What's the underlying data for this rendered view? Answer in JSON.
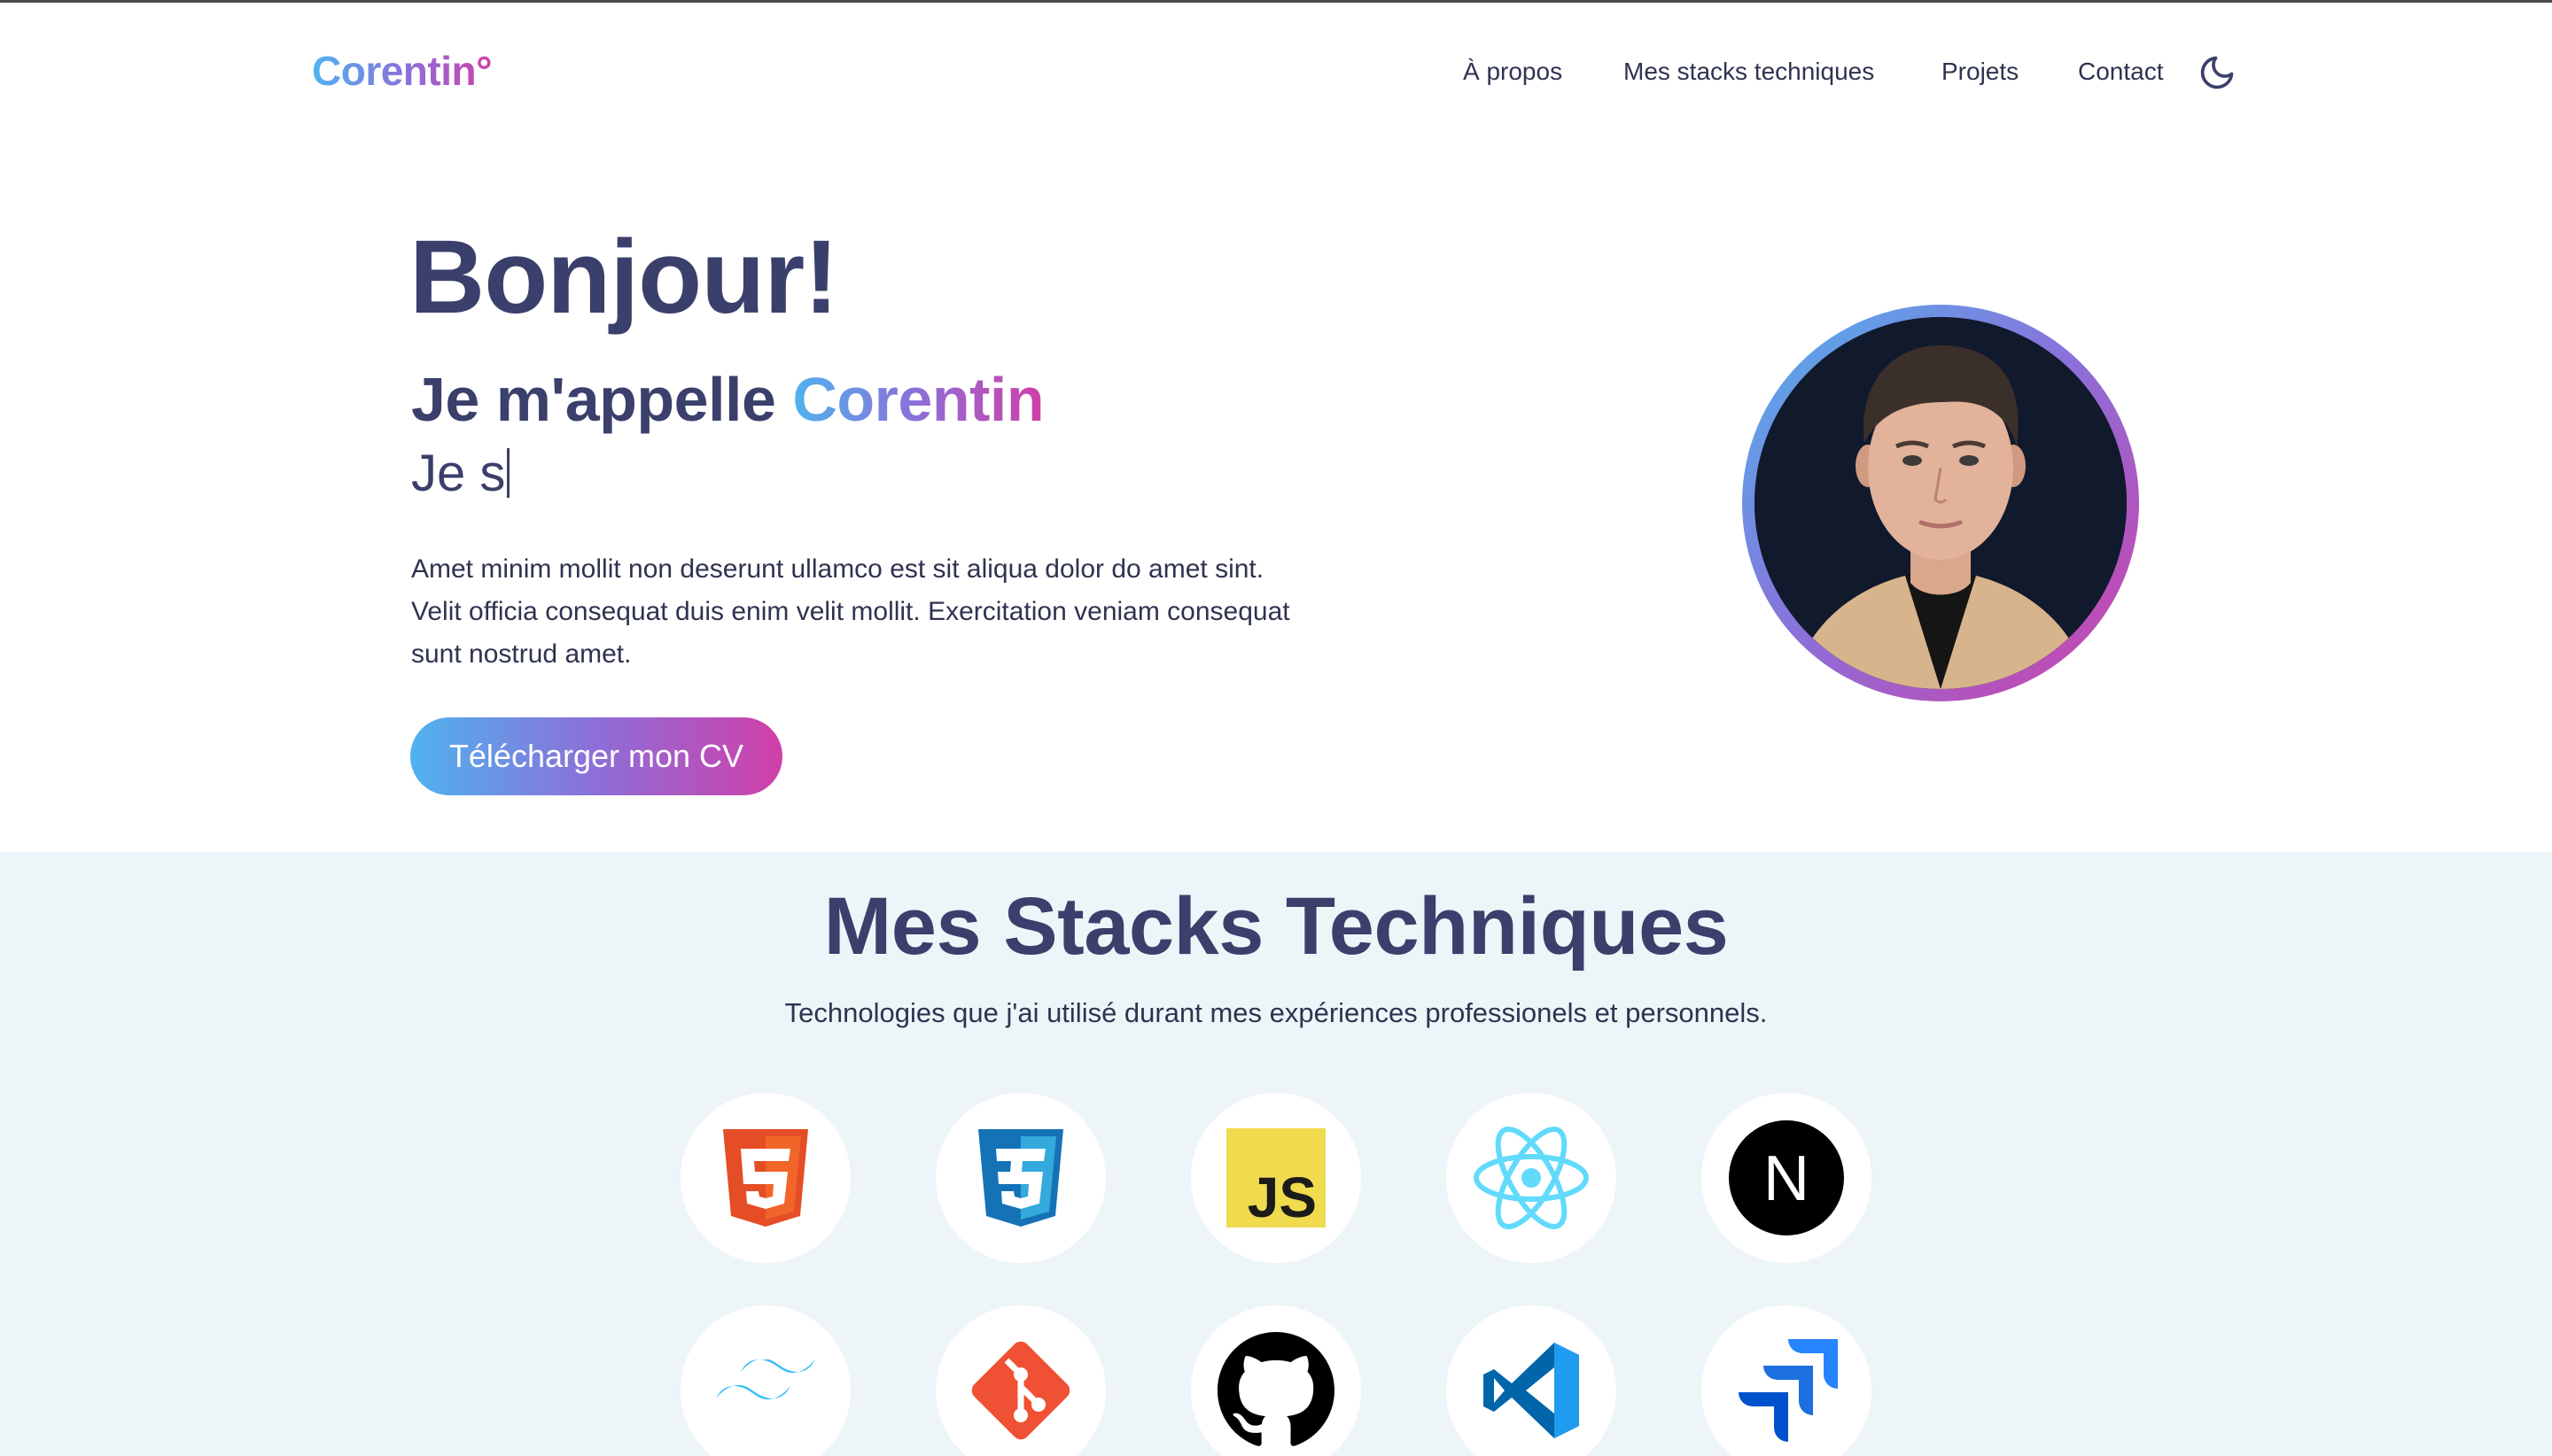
{
  "header": {
    "logo": "Corentin°",
    "nav": [
      {
        "label": "À propos"
      },
      {
        "label": "Mes stacks techniques"
      },
      {
        "label": "Projets"
      },
      {
        "label": "Contact"
      }
    ],
    "theme_icon": "moon-icon"
  },
  "hero": {
    "greeting": "Bonjour!",
    "name_prefix": "Je m'appelle ",
    "name": "Corentin",
    "typed_text": "Je s",
    "description": "Amet minim mollit non deserunt ullamco est sit aliqua dolor do amet sint. Velit officia consequat duis enim velit mollit. Exercitation veniam consequat sunt nostrud amet.",
    "cv_button": "Télécharger mon CV",
    "avatar_icon": "profile-photo"
  },
  "stacks": {
    "title": "Mes Stacks Techniques",
    "subtitle": "Technologies que j'ai utilisé durant mes expériences professionels et personnels.",
    "items": [
      {
        "icon": "html5-icon"
      },
      {
        "icon": "css3-icon"
      },
      {
        "icon": "javascript-icon",
        "label": "JS"
      },
      {
        "icon": "react-icon"
      },
      {
        "icon": "nextjs-icon",
        "label": "N"
      },
      {
        "icon": "tailwind-icon"
      },
      {
        "icon": "git-icon"
      },
      {
        "icon": "github-icon"
      },
      {
        "icon": "vscode-icon"
      },
      {
        "icon": "jira-icon"
      }
    ]
  },
  "colors": {
    "gradient_start": "#4fb3ee",
    "gradient_mid": "#8d6ed8",
    "gradient_end": "#d13fa8",
    "text_dark": "#3b3f6b",
    "section_bg": "#eef5f9"
  }
}
